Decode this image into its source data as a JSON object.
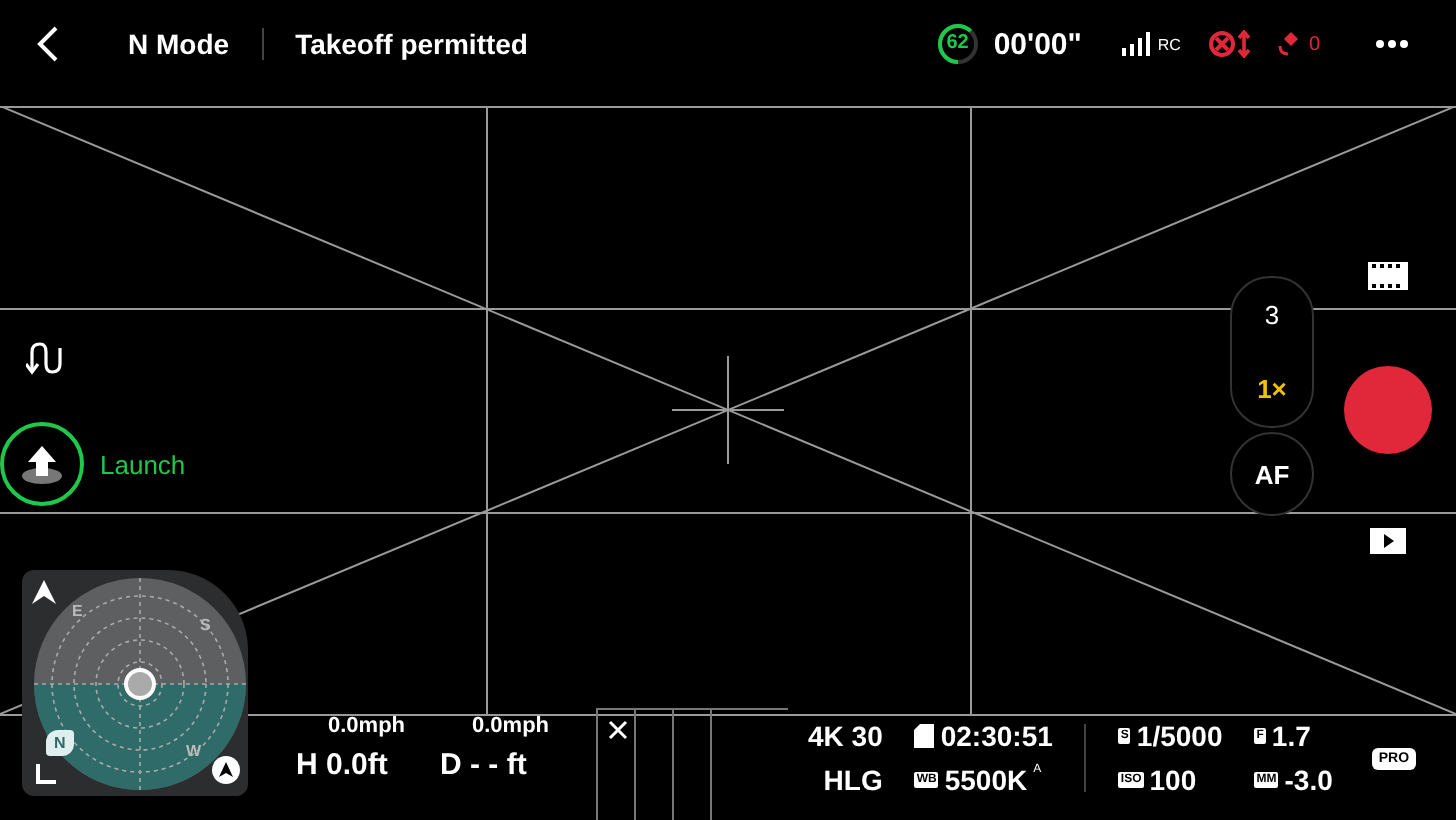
{
  "top_bar": {
    "mode": "N Mode",
    "status": "Takeoff permitted",
    "battery": {
      "value": "62",
      "level": 0.62
    },
    "flight_time": "00'00\"",
    "signal_label": "RC",
    "alert_count": "0"
  },
  "left_tools": {
    "launch_label": "Launch"
  },
  "compass": {
    "letters": [
      "E",
      "S",
      "W",
      "N"
    ]
  },
  "telemetry": {
    "h_speed": "0.0mph",
    "v_speed": "0.0mph",
    "height": "H 0.0ft",
    "distance": "D - - ft"
  },
  "camera": {
    "resolution": "4K 30",
    "color_profile": "HLG",
    "remaining": "02:30:51",
    "wb_badge": "WB",
    "white_balance": "5500K",
    "wb_mode": "A",
    "shutter_badge": "S",
    "shutter": "1/5000",
    "aperture_badge": "F",
    "aperture": "1.7",
    "iso_badge": "ISO",
    "iso": "100",
    "ev_badge": "MM",
    "ev": "-3.0",
    "pro_badge": "PRO"
  },
  "zoom_levels": [
    {
      "label": "3",
      "selected": false
    },
    {
      "label": "1×",
      "selected": true
    }
  ],
  "focus_mode": "AF"
}
